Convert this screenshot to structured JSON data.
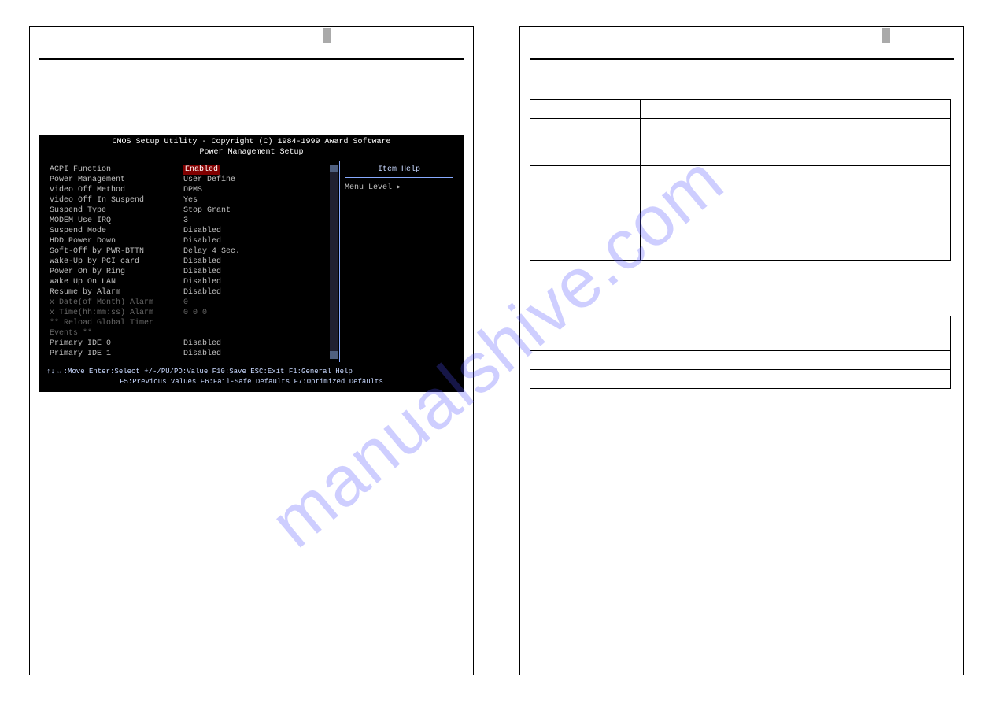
{
  "watermark": "manualshive.com",
  "bios": {
    "title1": "CMOS Setup Utility - Copyright (C) 1984-1999 Award Software",
    "title2": "Power Management Setup",
    "help_title": "Item Help",
    "help_menu": "Menu Level    ▸",
    "rows": [
      {
        "k": "ACPI Function",
        "v": "Enabled",
        "hl": true
      },
      {
        "k": "Power Management",
        "v": "User Define"
      },
      {
        "k": "Video Off Method",
        "v": "DPMS"
      },
      {
        "k": "Video Off In Suspend",
        "v": "Yes"
      },
      {
        "k": "Suspend Type",
        "v": "Stop Grant"
      },
      {
        "k": "MODEM Use IRQ",
        "v": "3"
      },
      {
        "k": "Suspend Mode",
        "v": "Disabled"
      },
      {
        "k": "HDD Power Down",
        "v": "Disabled"
      },
      {
        "k": "Soft-Off by PWR-BTTN",
        "v": "Delay 4 Sec."
      },
      {
        "k": "Wake-Up by PCI card",
        "v": "Disabled"
      },
      {
        "k": "Power On by Ring",
        "v": "Disabled"
      },
      {
        "k": "Wake Up On LAN",
        "v": "Disabled"
      },
      {
        "k": "Resume by Alarm",
        "v": "Disabled"
      },
      {
        "k": "x  Date(of Month) Alarm",
        "v": "0",
        "dim": true
      },
      {
        "k": "x  Time(hh:mm:ss) Alarm",
        "v": "0    0    0",
        "dim": true
      },
      {
        "k": "",
        "v": ""
      },
      {
        "k": "** Reload Global Timer Events **",
        "v": "",
        "dim": true
      },
      {
        "k": "Primary IDE 0",
        "v": "Disabled"
      },
      {
        "k": "Primary IDE 1",
        "v": "Disabled"
      }
    ],
    "footer1": "↑↓→←:Move  Enter:Select  +/-/PU/PD:Value  F10:Save  ESC:Exit  F1:General Help",
    "footer2": "F5:Previous Values   F6:Fail-Safe Defaults   F7:Optimized Defaults"
  },
  "rtable1": {
    "rows": [
      {
        "h": 1
      },
      {
        "tall": 1
      },
      {
        "tall": 1
      },
      {
        "tall": 1
      }
    ]
  },
  "rtable2": {
    "rows": [
      {
        "tall": 1
      },
      {
        "h": 1
      },
      {
        "h": 1
      }
    ]
  }
}
